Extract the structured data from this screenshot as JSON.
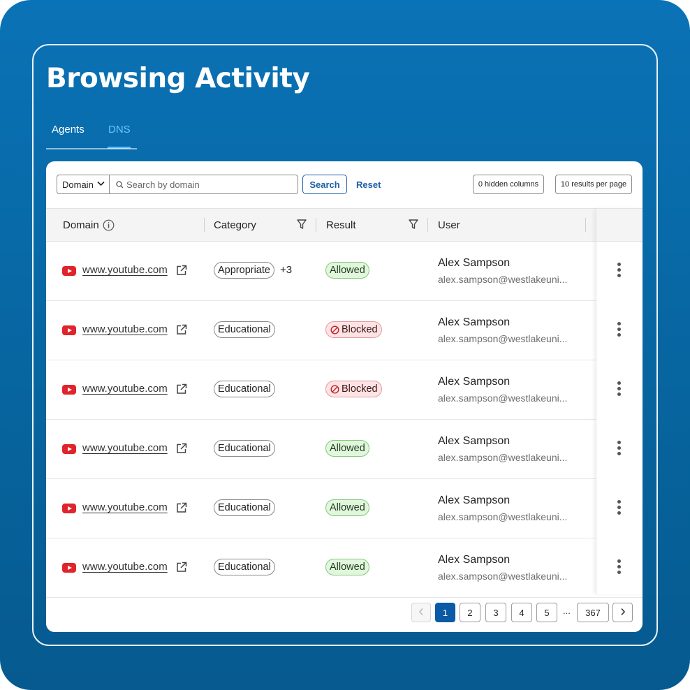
{
  "page": {
    "title": "Browsing Activity"
  },
  "tabs": [
    {
      "label": "Agents"
    },
    {
      "label": "DNS"
    }
  ],
  "toolbar": {
    "filter_select": "Domain",
    "search_placeholder": "Search by domain",
    "search_label": "Search",
    "reset_label": "Reset",
    "hidden_columns_label": "0 hidden columns",
    "per_page_label": "10 results per page"
  },
  "table": {
    "headers": {
      "domain": "Domain",
      "category": "Category",
      "result": "Result",
      "user": "User"
    },
    "rows": [
      {
        "domain": "www.youtube.com",
        "category": "Appropriate",
        "more": "+3",
        "result": "Allowed",
        "user_name": "Alex Sampson",
        "user_email": "alex.sampson@westlakeuni..."
      },
      {
        "domain": "www.youtube.com",
        "category": "Educational",
        "more": "",
        "result": "Blocked",
        "user_name": "Alex Sampson",
        "user_email": "alex.sampson@westlakeuni..."
      },
      {
        "domain": "www.youtube.com",
        "category": "Educational",
        "more": "",
        "result": "Blocked",
        "user_name": "Alex Sampson",
        "user_email": "alex.sampson@westlakeuni..."
      },
      {
        "domain": "www.youtube.com",
        "category": "Educational",
        "more": "",
        "result": "Allowed",
        "user_name": "Alex Sampson",
        "user_email": "alex.sampson@westlakeuni..."
      },
      {
        "domain": "www.youtube.com",
        "category": "Educational",
        "more": "",
        "result": "Allowed",
        "user_name": "Alex Sampson",
        "user_email": "alex.sampson@westlakeuni..."
      },
      {
        "domain": "www.youtube.com",
        "category": "Educational",
        "more": "",
        "result": "Allowed",
        "user_name": "Alex Sampson",
        "user_email": "alex.sampson@westlakeuni..."
      }
    ]
  },
  "pagination": {
    "pages": [
      "1",
      "2",
      "3",
      "4",
      "5"
    ],
    "ellipsis": "...",
    "last": "367",
    "current": "1"
  },
  "colors": {
    "accent": "#0b5aa6",
    "background": "#0a72b6",
    "allowed": "#e1f6dd",
    "blocked": "#fde3e4",
    "youtube": "#e0242b"
  }
}
